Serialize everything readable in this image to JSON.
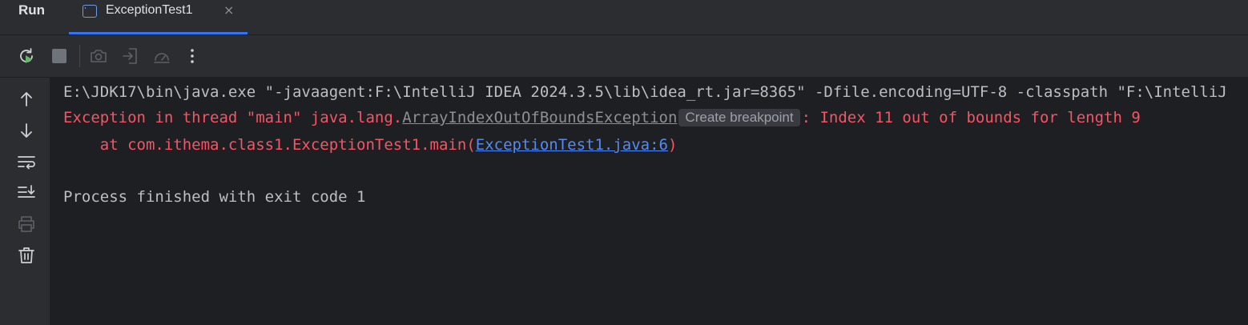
{
  "tabbar": {
    "run_label": "Run",
    "tab": {
      "title": "ExceptionTest1",
      "icon": "console-window-icon",
      "close_glyph": "×"
    }
  },
  "toolbar": {
    "buttons": [
      {
        "icon": "rerun-icon",
        "enabled": true,
        "color": "#5fb865"
      },
      {
        "icon": "stop-icon",
        "enabled": false
      },
      {
        "icon": "camera-icon",
        "enabled": false
      },
      {
        "icon": "exit-icon",
        "enabled": false
      },
      {
        "icon": "profiler-gauge-icon",
        "enabled": false
      },
      {
        "icon": "more-icon",
        "enabled": true
      }
    ]
  },
  "left_rail": {
    "buttons": [
      {
        "icon": "arrow-up-icon"
      },
      {
        "icon": "arrow-down-icon"
      },
      {
        "icon": "soft-wrap-icon"
      },
      {
        "icon": "scroll-to-end-icon"
      },
      {
        "icon": "print-icon",
        "enabled": false
      },
      {
        "icon": "trash-icon"
      }
    ]
  },
  "console": {
    "command_line": "E:\\JDK17\\bin\\java.exe \"-javaagent:F:\\IntelliJ IDEA 2024.3.5\\lib\\idea_rt.jar=8365\" -Dfile.encoding=UTF-8 -classpath \"F:\\IntelliJ",
    "exception": {
      "prefix": "Exception in thread \"main\" java.lang.",
      "class_link": "ArrayIndexOutOfBoundsException",
      "breakpoint_chip": "Create breakpoint",
      "message": ": Index 11 out of bounds for length 9"
    },
    "stack_frame": {
      "prefix": "    at com.ithema.class1.ExceptionTest1.main(",
      "source_link": "ExceptionTest1.java:6",
      "suffix": ")"
    },
    "process_status": "Process finished with exit code 1"
  },
  "colors": {
    "background": "#1e1f22",
    "panel": "#2b2d30",
    "error_text": "#f75464",
    "normal_text": "#bcbec4",
    "link": "#548af7",
    "tab_underline": "#3574f0"
  }
}
